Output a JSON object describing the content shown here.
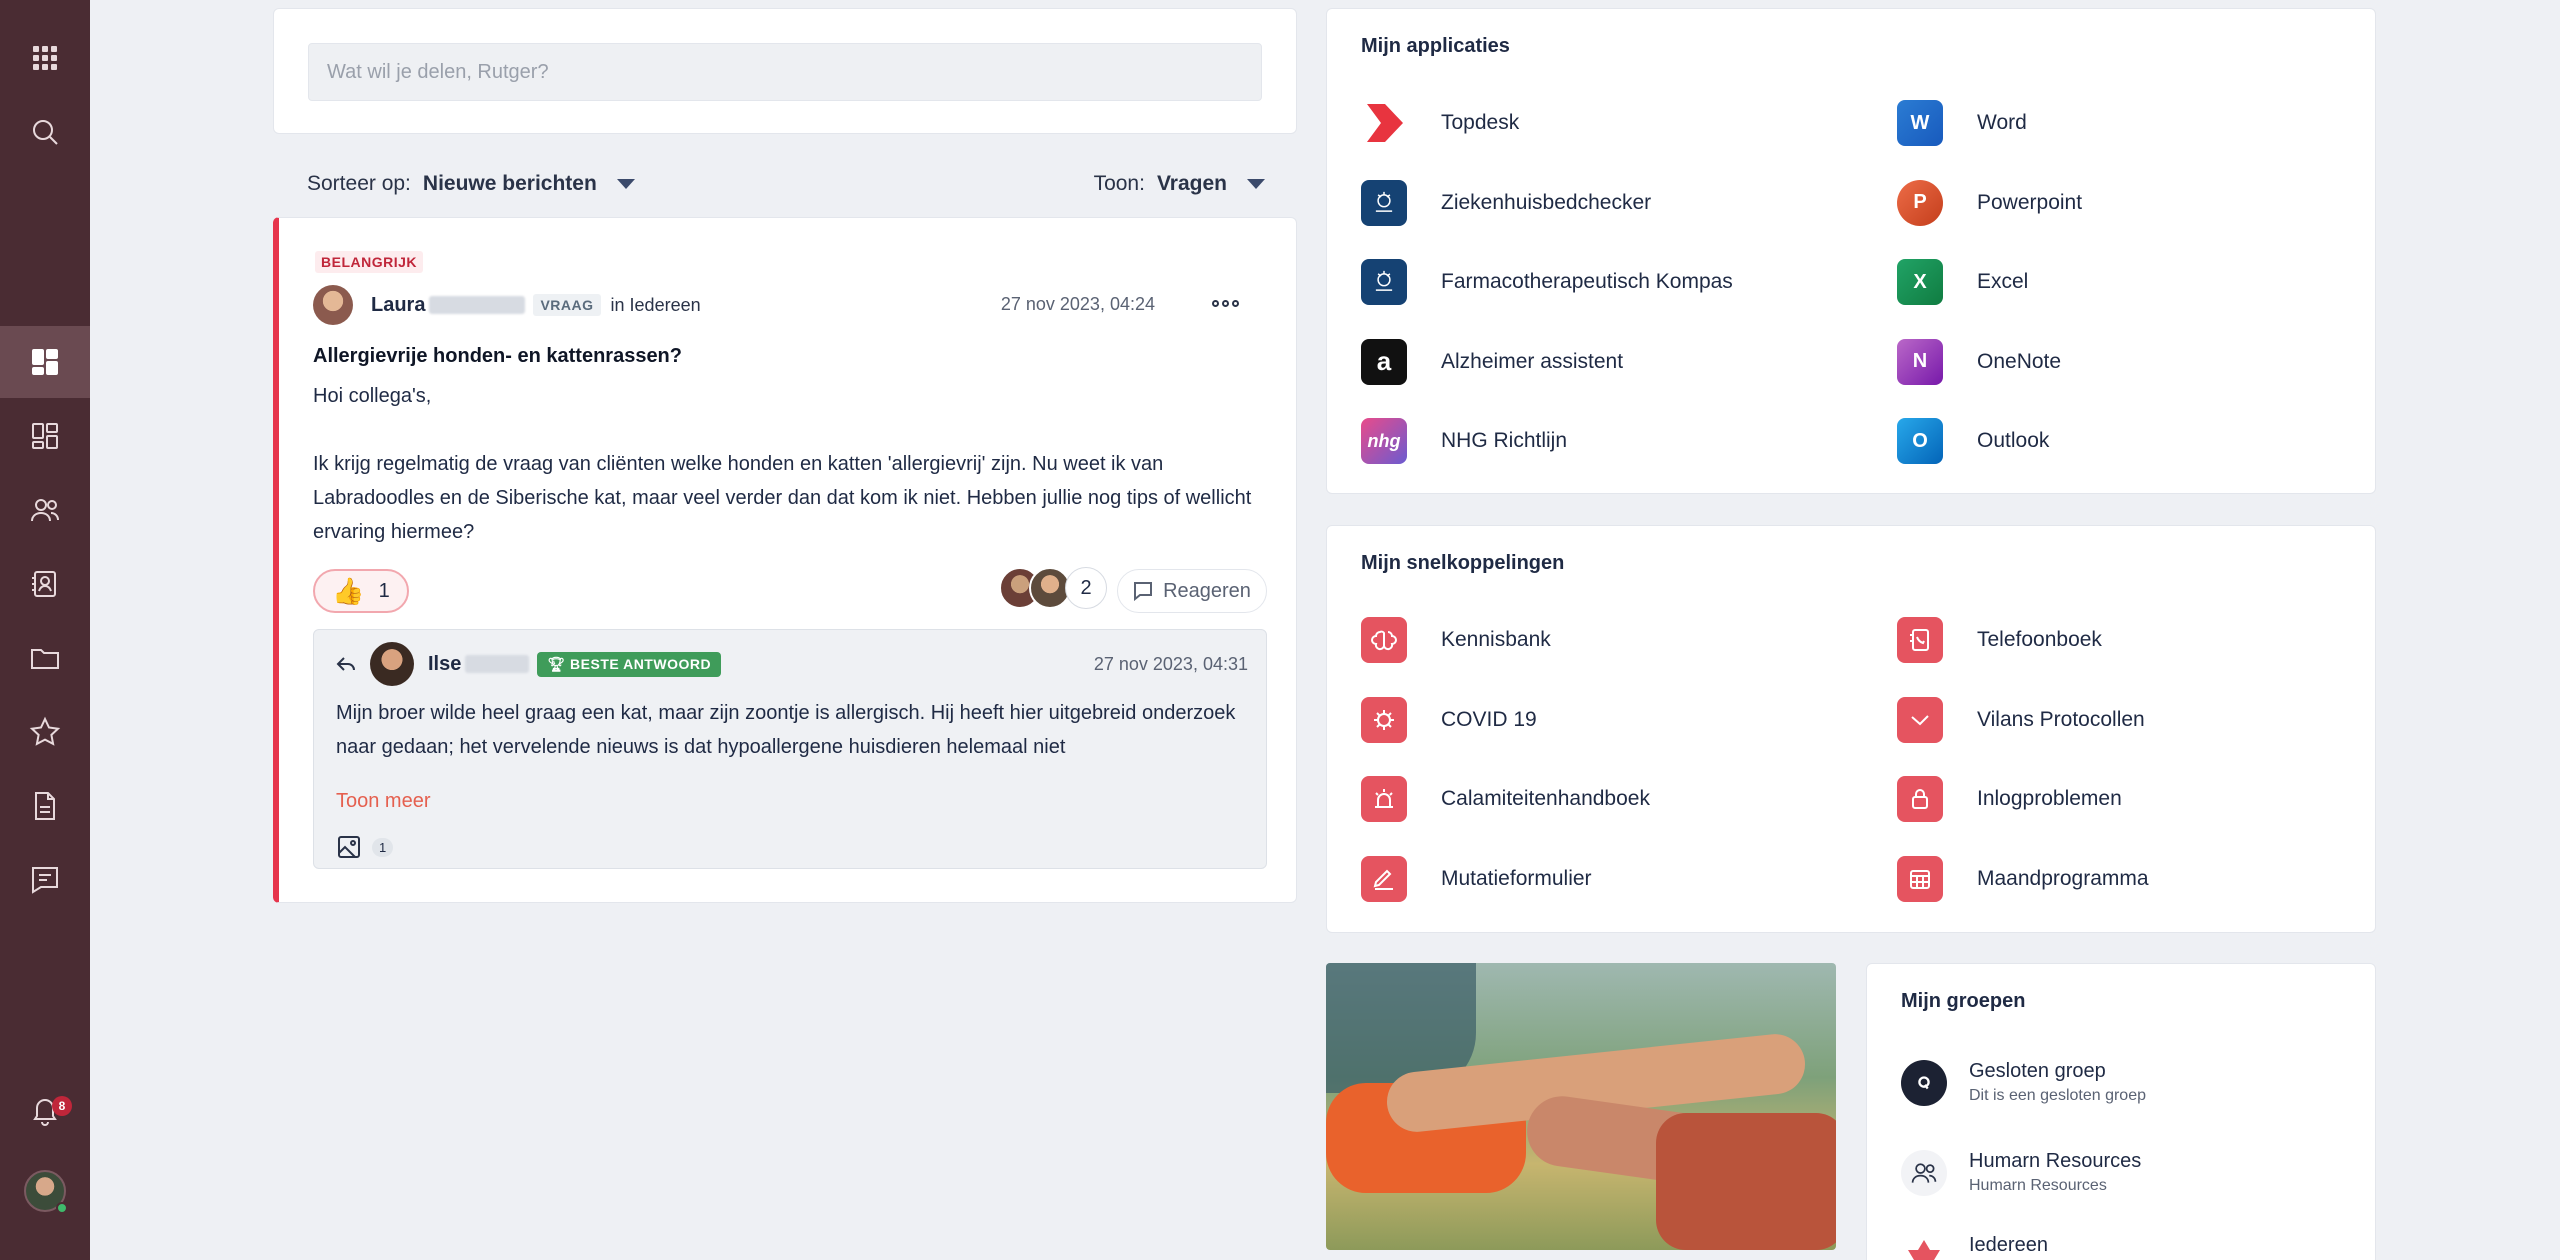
{
  "sidebar": {
    "notifications_count": "8"
  },
  "composer": {
    "placeholder": "Wat wil je delen, Rutger?"
  },
  "sortbar": {
    "sort_label": "Sorteer op:",
    "sort_value": "Nieuwe berichten",
    "show_label": "Toon:",
    "show_value": "Vragen"
  },
  "post": {
    "tag": "BELANGRIJK",
    "author": "Laura",
    "type_tag": "VRAAG",
    "group": "in Iedereen",
    "time": "27 nov 2023, 04:24",
    "title": "Allergievrije honden- en kattenrassen?",
    "body": "Hoi collega's,\n\nIk krijg regelmatig de vraag van cliënten welke honden en katten 'allergievrij' zijn. Nu weet ik van Labradoodles en de Siberische kat, maar veel verder dan dat kom ik niet. Hebben jullie nog tips of wellicht ervaring hiermee?",
    "likes": "1",
    "reactors_count": "2",
    "reply_label": "Reageren"
  },
  "answer": {
    "author": "Ilse",
    "best_label": "BESTE ANTWOORD",
    "time": "27 nov 2023, 04:31",
    "body": "Mijn broer wilde heel graag een kat, maar zijn zoontje is allergisch. Hij heeft hier uitgebreid onderzoek naar gedaan; het vervelende nieuws is dat hypoallergene huisdieren helemaal niet",
    "show_more": "Toon meer",
    "attachments": "1"
  },
  "apps": {
    "title": "Mijn applicaties",
    "items": [
      {
        "label": "Topdesk",
        "icon": "topdesk-icon"
      },
      {
        "label": "Word",
        "icon": "word-icon",
        "letter": "W"
      },
      {
        "label": "Ziekenhuisbedchecker",
        "icon": "rijksoverheid-icon"
      },
      {
        "label": "Powerpoint",
        "icon": "powerpoint-icon",
        "letter": "P"
      },
      {
        "label": "Farmacotherapeutisch Kompas",
        "icon": "rijksoverheid-icon"
      },
      {
        "label": "Excel",
        "icon": "excel-icon",
        "letter": "X"
      },
      {
        "label": "Alzheimer assistent",
        "icon": "alzheimer-icon",
        "letter": "a"
      },
      {
        "label": "OneNote",
        "icon": "onenote-icon",
        "letter": "N"
      },
      {
        "label": "NHG Richtlijn",
        "icon": "nhg-icon",
        "letter": "nhg"
      },
      {
        "label": "Outlook",
        "icon": "outlook-icon",
        "letter": "O"
      }
    ]
  },
  "shortcuts": {
    "title": "Mijn snelkoppelingen",
    "items": [
      {
        "label": "Kennisbank",
        "icon": "brain-icon"
      },
      {
        "label": "Telefoonboek",
        "icon": "phonebook-icon"
      },
      {
        "label": "COVID 19",
        "icon": "virus-icon"
      },
      {
        "label": "Vilans Protocollen",
        "icon": "protocol-icon"
      },
      {
        "label": "Calamiteitenhandboek",
        "icon": "alarm-icon"
      },
      {
        "label": "Inlogproblemen",
        "icon": "lock-icon"
      },
      {
        "label": "Mutatieformulier",
        "icon": "edit-icon"
      },
      {
        "label": "Maandprogramma",
        "icon": "calendar-icon"
      }
    ]
  },
  "groups": {
    "title": "Mijn groepen",
    "items": [
      {
        "name": "Gesloten groep",
        "sub": "Dit is een gesloten groep"
      },
      {
        "name": "Humarn Resources",
        "sub": "Humarn Resources"
      },
      {
        "name": "Iedereen",
        "sub": ""
      }
    ]
  }
}
